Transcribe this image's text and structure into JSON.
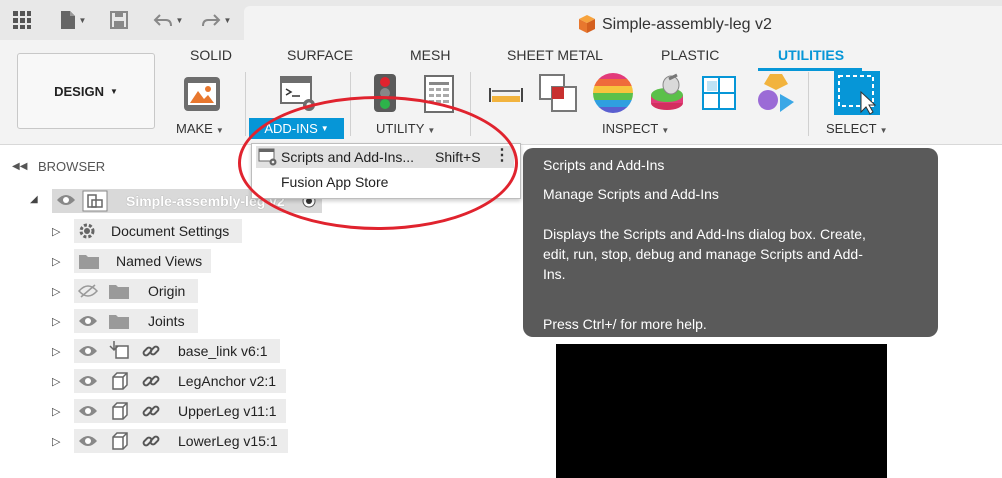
{
  "document": {
    "title": "Simple-assembly-leg v2"
  },
  "ribbon": {
    "design_label": "DESIGN",
    "tabs": [
      "SOLID",
      "SURFACE",
      "MESH",
      "SHEET METAL",
      "PLASTIC",
      "UTILITIES"
    ],
    "active_tab": "UTILITIES",
    "groups": {
      "make": "MAKE",
      "addins": "ADD-INS",
      "utility": "UTILITY",
      "inspect": "INSPECT",
      "select": "SELECT"
    }
  },
  "browser": {
    "title": "BROWSER",
    "root": "Simple-assembly-leg v2",
    "items": [
      "Document Settings",
      "Named Views",
      "Origin",
      "Joints",
      "base_link v6:1",
      "LegAnchor v2:1",
      "UpperLeg v11:1",
      "LowerLeg v15:1"
    ]
  },
  "dropdown": {
    "items": [
      {
        "label": "Scripts and Add-Ins...",
        "shortcut": "Shift+S"
      },
      {
        "label": "Fusion App Store"
      }
    ]
  },
  "tooltip": {
    "title": "Scripts and Add-Ins",
    "subtitle": "Manage Scripts and Add-Ins",
    "description_lines": [
      "Displays the Scripts and Add-Ins dialog box. Create,",
      "edit, run, stop, debug and manage Scripts and Add-",
      "Ins."
    ],
    "help": "Press Ctrl+/ for more help."
  },
  "colors": {
    "accent": "#0696d7",
    "annotation": "#e0232e",
    "tooltip_bg": "#5a5a5a"
  },
  "icons": [
    "grid-icon",
    "file-icon",
    "save-icon",
    "undo-icon",
    "redo-icon",
    "cube-icon",
    "eye-icon",
    "folder-icon",
    "gear-icon",
    "link-icon",
    "component-icon"
  ]
}
